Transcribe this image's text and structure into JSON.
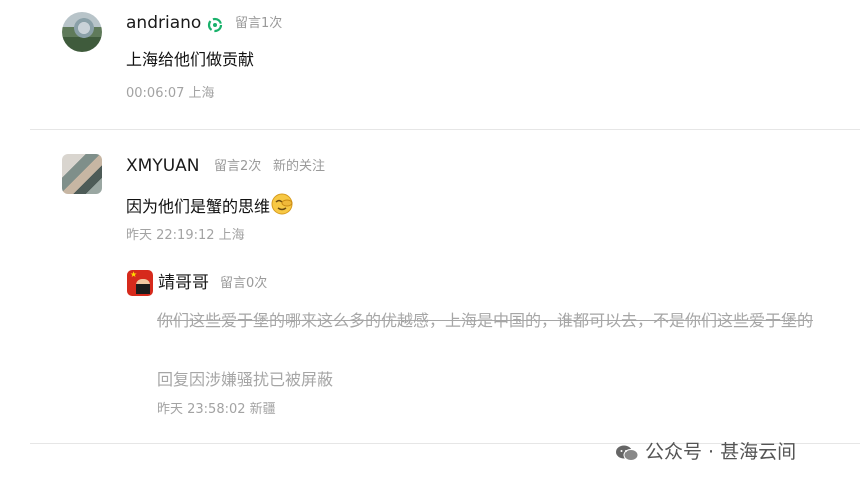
{
  "comments": [
    {
      "user": "andriano",
      "count": "留言1次",
      "text": "上海给他们做贡献",
      "time": "00:06:07 上海"
    },
    {
      "user": "XMYUAN",
      "count": "留言2次",
      "badge": "新的关注",
      "text": "因为他们是蟹的思维",
      "time": "昨天 22:19:12 上海",
      "reply": {
        "user": "靖哥哥",
        "count": "留言0次",
        "deleted_text": "你们这些爱于堡的哪来这么多的优越感，上海是中国的，谁都可以去，不是你们这些爱于堡的",
        "notice": "回复因涉嫌骚扰已被屏蔽",
        "time": "昨天 23:58:02 新疆"
      }
    }
  ],
  "watermark": "公众号 · 甚海云间",
  "icons": {
    "verify": "verified-badge-icon",
    "emoji": "facepalm-emoji-icon",
    "wechat": "wechat-icon"
  },
  "colors": {
    "verify": "#19b16b",
    "muted": "#9a9a9a"
  }
}
